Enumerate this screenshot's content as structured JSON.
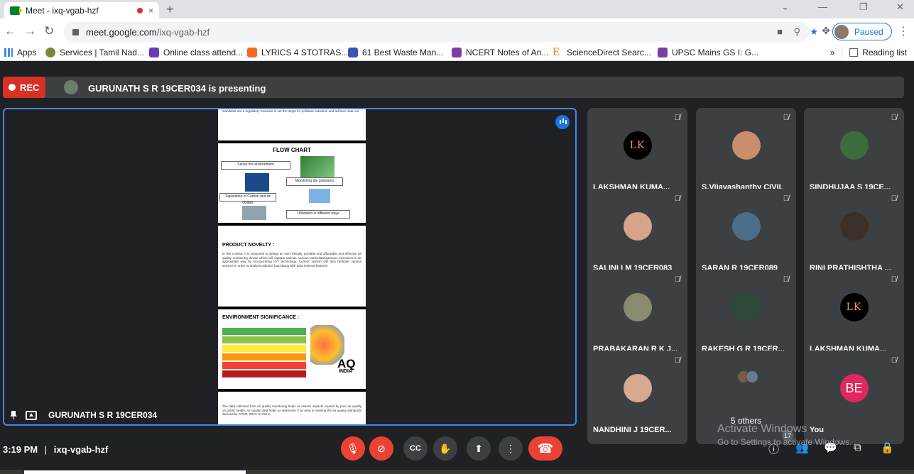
{
  "browser": {
    "tab_title": "Meet - ixq-vgab-hzf",
    "tab_close": "×",
    "new_tab": "+",
    "url_domain": "meet.google.com",
    "url_path": "/ixq-vgab-hzf",
    "profile_status": "Paused",
    "bookmarks": [
      {
        "label": "Apps",
        "color": "#4285f4"
      },
      {
        "label": "Services | Tamil Nad...",
        "color": "#7a8a3a"
      },
      {
        "label": "Online class attend...",
        "color": "#673ab7"
      },
      {
        "label": "LYRICS 4 STOTRAS...",
        "color": "#f06a25"
      },
      {
        "label": "61 Best Waste Man...",
        "color": "#3f51b5"
      },
      {
        "label": "NCERT Notes of An...",
        "color": "#7b3fa0"
      },
      {
        "label": "ScienceDirect Searc...",
        "color": "#f58220"
      },
      {
        "label": "UPSC Mains GS I: G...",
        "color": "#7b3fa0"
      }
    ],
    "bookmarks_more": "»",
    "reading_list": "Reading list"
  },
  "meet": {
    "rec_label": "REC",
    "presenting_text": "GURUNATH S R 19CER034 is presenting",
    "stage_label": "GURUNATH S R 19CER034",
    "time": "3:19 PM",
    "separator": "|",
    "meeting_code": "ixq-vgab-hzf",
    "participants_count": "17",
    "slides": {
      "top_text": "standards are a regulatory measure to set the target for pollutant reduction and achieve clean air.",
      "flow_title": "FLOW CHART",
      "flow_boxes": [
        "Sense the environment",
        "Monitoring the pollutants",
        "Separation of Carbon and its Oxides",
        "Utilization in different ways"
      ],
      "novelty_title": "PRODUCT NOVELTY :",
      "novelty_text": "In this context, it is proposed to design an user friendly, portable and affordable and effective air quality monitoring device which will capture various noxious particulate/gaseous emissions in an appropriate way by incorporating IOT technology. Current system will also facilitate various sensors in order to analyze pollution load along with data retrieval features.",
      "env_title": "ENVIRONMENT SIGNIFICANCE :",
      "aq_label": "AQ",
      "aq_sub": "INDIA",
      "aq_bands": [
        "#4caf50",
        "#8bc34a",
        "#ffeb3b",
        "#ff9800",
        "#f44336",
        "#b71c1c"
      ],
      "bottom_text": "The data collected from air quality monitoring helps us assess impacts caused by poor air quality on public health. Air quality data helps us determine if an area is meeting the air quality standards devised by CPCB, WHO or OSHA."
    },
    "participants": [
      {
        "name": "LAKSHMAN KUMA...",
        "avatar": "LK",
        "kind": "initials"
      },
      {
        "name": "S.Vijayashanthy CIVIL",
        "kind": "photo",
        "color": "#c98f6a"
      },
      {
        "name": "SINDHUJAA S 19CE...",
        "kind": "photo",
        "color": "#3e6b3a"
      },
      {
        "name": "SALINI I M 19CER083",
        "kind": "photo",
        "color": "#d7a488"
      },
      {
        "name": "SARAN R 19CER089",
        "kind": "photo",
        "color": "#4a6e8a"
      },
      {
        "name": "RINI PRATHISHTHA ...",
        "kind": "photo",
        "color": "#3a3028"
      },
      {
        "name": "PRABAKARAN R K J...",
        "kind": "photo",
        "color": "#8a8a6e"
      },
      {
        "name": "RAKESH G R 19CER...",
        "kind": "photo",
        "color": "#2e4a3a"
      },
      {
        "name": "LAKSHMAN KUMA...",
        "avatar": "LK",
        "kind": "initials"
      },
      {
        "name": "NANDHINI J 19CER...",
        "kind": "photo",
        "color": "#d9a890"
      },
      {
        "name": "5 others",
        "kind": "others"
      },
      {
        "name": "You",
        "avatar": "BE",
        "kind": "self"
      }
    ]
  },
  "watermark": {
    "line1": "Activate Windows",
    "line2": "Go to Settings to activate Windows."
  }
}
